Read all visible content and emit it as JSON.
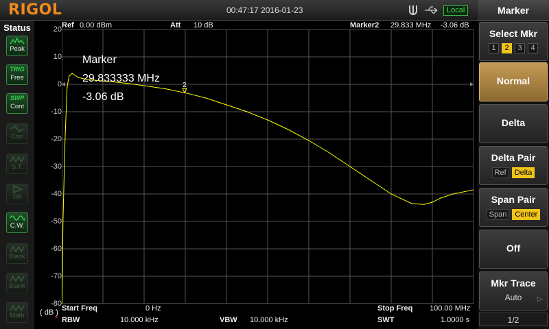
{
  "topbar": {
    "logo": "RIGOL",
    "datetime": "00:47:17 2016-01-23",
    "local": "Local"
  },
  "status": {
    "label": "Status",
    "buttons": [
      {
        "top": "",
        "bottom": "Peak",
        "icon": "peak-icon"
      },
      {
        "top": "TRIG",
        "bottom": "Free"
      },
      {
        "top": "SWP",
        "bottom": "Cont"
      },
      {
        "top": "",
        "bottom": "Corr",
        "icon": "corr-icon"
      },
      {
        "top": "",
        "bottom": "S.T.",
        "icon": "st-icon"
      },
      {
        "top": "",
        "bottom": "PA",
        "icon": "pa-icon"
      },
      {
        "top": "",
        "bottom": "C.W.",
        "icon": "cw-icon"
      },
      {
        "top": "",
        "bottom": "Blank",
        "icon": "blank-icon"
      },
      {
        "top": "",
        "bottom": "Blank",
        "icon": "blank-icon"
      },
      {
        "top": "",
        "bottom": "Math",
        "icon": "math-icon"
      }
    ]
  },
  "header": {
    "ref": "Ref",
    "ref_val": "0.00 dBm",
    "att": "Att",
    "att_val": "10 dB",
    "marker_name": "Marker2",
    "marker_freq": "29.833 MHz",
    "marker_amp": "-3.06 dB"
  },
  "axis": {
    "unit": "( dB )",
    "ticks": [
      "20",
      "10",
      "0",
      "-10",
      "-20",
      "-30",
      "-40",
      "-50",
      "-60",
      "-70",
      "-80"
    ]
  },
  "readout": {
    "line1": "Marker",
    "line2": "29.833333 MHz",
    "line3": "-3.06 dB"
  },
  "marker_label": "2",
  "footer": {
    "start_label": "Start Freq",
    "start_val": "0 Hz",
    "stop_label": "Stop Freq",
    "stop_val": "100.00 MHz",
    "rbw_label": "RBW",
    "rbw_val": "10.000 kHz",
    "vbw_label": "VBW",
    "vbw_val": "10.000 kHz",
    "swt_label": "SWT",
    "swt_val": "1.0000 s"
  },
  "menu": {
    "title": "Marker",
    "select_mkr": "Select Mkr",
    "mkr_nums": [
      "1",
      "2",
      "3",
      "4"
    ],
    "normal": "Normal",
    "delta": "Delta",
    "delta_pair": "Delta Pair",
    "dp_ref": "Ref",
    "dp_delta": "Delta",
    "span_pair": "Span Pair",
    "sp_span": "Span",
    "sp_center": "Center",
    "off": "Off",
    "mkr_trace": "Mkr Trace",
    "mkr_trace_val": "Auto",
    "page": "1/2"
  },
  "colors": {
    "trace": "#ffff00",
    "logo": "#f08a1c",
    "selected_softkey": "#c49a55",
    "status_green": "#35d24d"
  },
  "chart_data": {
    "type": "line",
    "x_unit": "MHz",
    "y_unit": "dB",
    "xlim": [
      0,
      100
    ],
    "ylim": [
      -80,
      20
    ],
    "x": [
      0.05,
      0.3,
      0.8,
      1.3,
      1.8,
      2.5,
      4,
      6,
      8,
      10,
      13,
      16,
      20,
      25,
      29.83,
      35,
      40,
      45,
      50,
      55,
      60,
      65,
      70,
      75,
      80,
      85,
      88,
      90,
      92,
      95,
      100
    ],
    "y": [
      -80,
      -50,
      -20,
      -1,
      3,
      4,
      2.5,
      1.8,
      1.5,
      1.2,
      0.8,
      0.3,
      -0.5,
      -1.6,
      -3.06,
      -5,
      -7.5,
      -10,
      -13,
      -16.5,
      -20.5,
      -25,
      -30,
      -35,
      -40,
      -43.5,
      -43.8,
      -43,
      -41.5,
      -40,
      -38.5
    ]
  }
}
